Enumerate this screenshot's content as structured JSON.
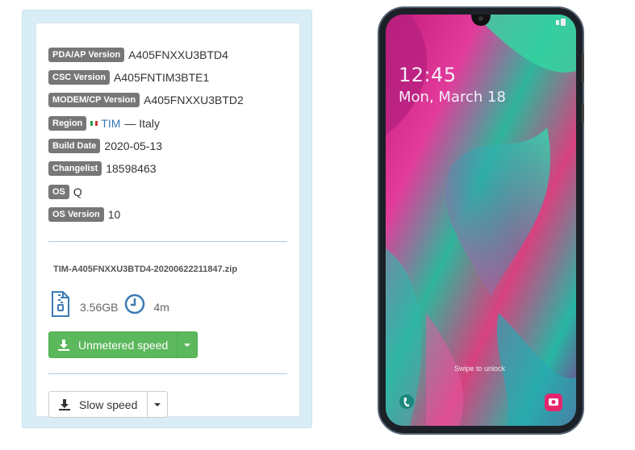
{
  "firmware": {
    "rows": [
      {
        "label": "PDA/AP Version",
        "value": "A405FNXXU3BTD4"
      },
      {
        "label": "CSC Version",
        "value": "A405FNTIM3BTE1"
      },
      {
        "label": "MODEM/CP Version",
        "value": "A405FNXXU3BTD2"
      },
      {
        "label": "Region",
        "carrier": "TIM",
        "value": "— Italy"
      },
      {
        "label": "Build Date",
        "value": "2020-05-13"
      },
      {
        "label": "Changelist",
        "value": "18598463"
      },
      {
        "label": "OS",
        "value": "Q"
      },
      {
        "label": "OS Version",
        "value": "10"
      }
    ]
  },
  "download": {
    "filename": "TIM-A405FNXXU3BTD4-20200622211847.zip",
    "size": "3.56GB",
    "time": "4m",
    "fast_label": "Unmetered speed",
    "slow_label": "Slow speed"
  },
  "phone": {
    "time": "12:45",
    "date": "Mon, March 18",
    "unlock_hint": "Swipe to unlock"
  },
  "icons": {
    "zip": "zip-file-icon",
    "clock": "clock-icon",
    "download": "download-icon",
    "caret": "caret-down-icon"
  },
  "colors": {
    "panel_bg": "#d9edf7",
    "label_bg": "#777777",
    "success": "#5cb85c",
    "link": "#337ab7"
  }
}
